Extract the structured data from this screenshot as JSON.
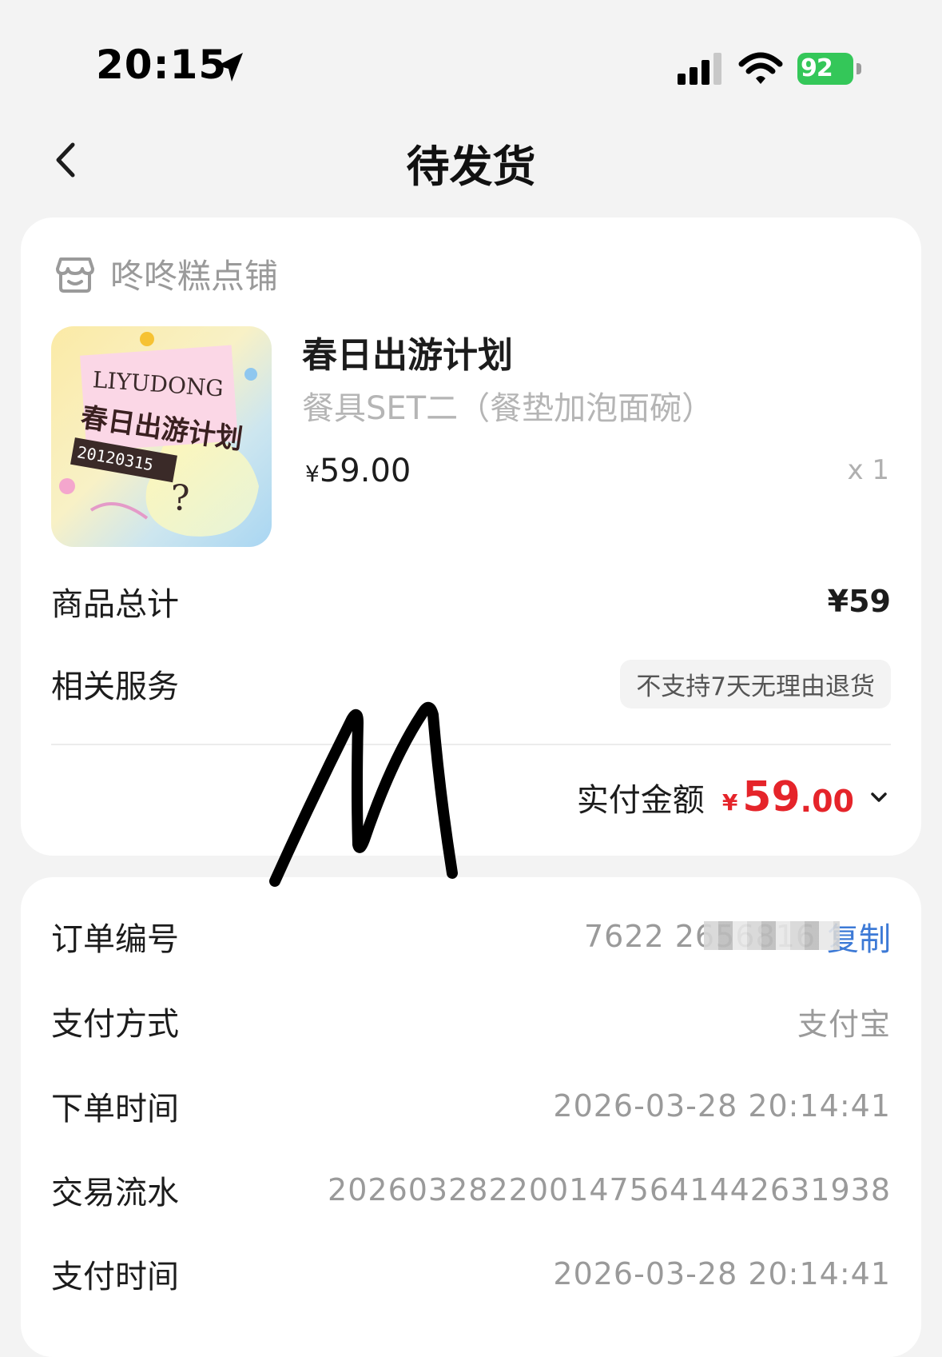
{
  "status_bar": {
    "time": "20:15",
    "battery": "92"
  },
  "nav": {
    "title": "待发货"
  },
  "shop": {
    "name": "咚咚糕点铺"
  },
  "product": {
    "title": "春日出游计划",
    "spec": "餐具SET二（餐垫加泡面碗）",
    "price_symbol": "¥",
    "price": "59.00",
    "quantity": "x 1",
    "thumb_text_1": "LIYUDONG",
    "thumb_text_2": "春日出游计划",
    "thumb_text_3": "20120315"
  },
  "summary": {
    "total_label": "商品总计",
    "total_value": "¥59",
    "service_label": "相关服务",
    "service_tag": "不支持7天无理由退货",
    "paid_label": "实付金额",
    "paid_symbol": "¥",
    "paid_int": "59",
    "paid_dec": ".00"
  },
  "order": {
    "id_label": "订单编号",
    "id_value": "7622        2656816",
    "copy_label": "复制",
    "pay_method_label": "支付方式",
    "pay_method_value": "支付宝",
    "order_time_label": "下单时间",
    "order_time_value": "2026-03-28 20:14:41",
    "txn_label": "交易流水",
    "txn_value": "2026032822001475641442631938",
    "pay_time_label": "支付时间",
    "pay_time_value": "2026-03-28 20:14:41"
  },
  "colors": {
    "accent_red": "#e5242a",
    "link_blue": "#3d7ad6",
    "battery_green": "#34c759"
  },
  "icons": [
    "location-arrow-icon",
    "signal-icon",
    "wifi-icon",
    "battery-icon",
    "back-chevron-icon",
    "shop-icon",
    "chevron-down-icon"
  ]
}
